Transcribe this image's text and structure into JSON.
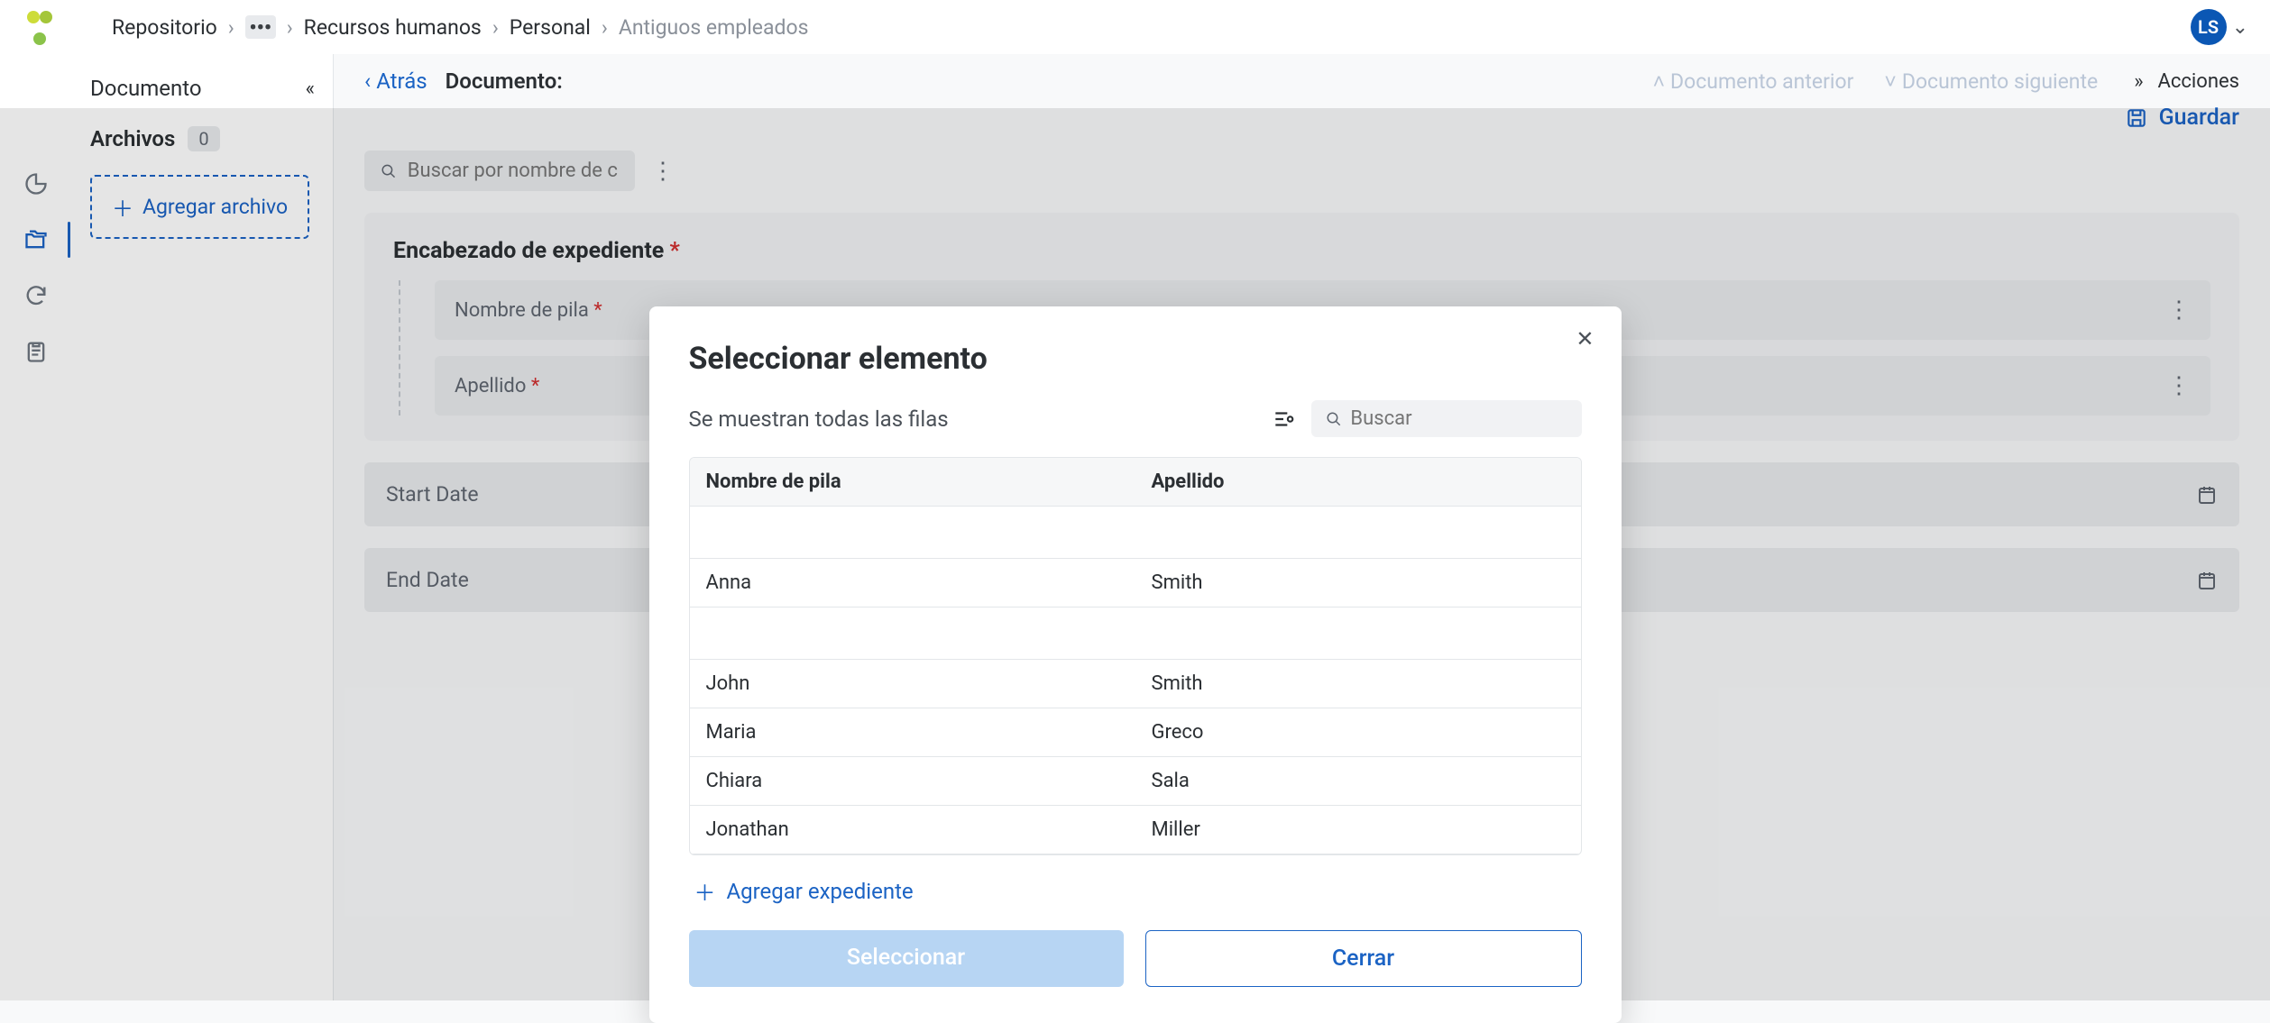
{
  "breadcrumb": {
    "repo": "Repositorio",
    "hr": "Recursos humanos",
    "personal": "Personal",
    "antiguos": "Antiguos empleados"
  },
  "avatar": "LS",
  "left_panel": {
    "title": "Documento",
    "archives_label": "Archivos",
    "archives_count": "0",
    "add_file": "Agregar archivo"
  },
  "content": {
    "back": "Atrás",
    "doc_label": "Documento:",
    "prev_doc": "Documento anterior",
    "next_doc": "Documento siguiente",
    "save": "Guardar",
    "search_placeholder": "Buscar por nombre de cam",
    "section_title": "Encabezado de expediente",
    "field_first": "Nombre de pila",
    "field_last": "Apellido",
    "start_date": "Start Date",
    "end_date": "End Date"
  },
  "right_actions": "Acciones",
  "modal": {
    "title": "Seleccionar elemento",
    "subtext": "Se muestran todas las filas",
    "search_placeholder": "Buscar",
    "col_first": "Nombre de pila",
    "col_last": "Apellido",
    "rows": [
      {
        "first": "",
        "last": ""
      },
      {
        "first": "Anna",
        "last": "Smith"
      },
      {
        "first": "",
        "last": ""
      },
      {
        "first": "John",
        "last": "Smith"
      },
      {
        "first": "Maria",
        "last": "Greco"
      },
      {
        "first": "Chiara",
        "last": "Sala"
      },
      {
        "first": "Jonathan",
        "last": "Miller"
      }
    ],
    "add_record": "Agregar expediente",
    "select_btn": "Seleccionar",
    "close_btn": "Cerrar"
  }
}
